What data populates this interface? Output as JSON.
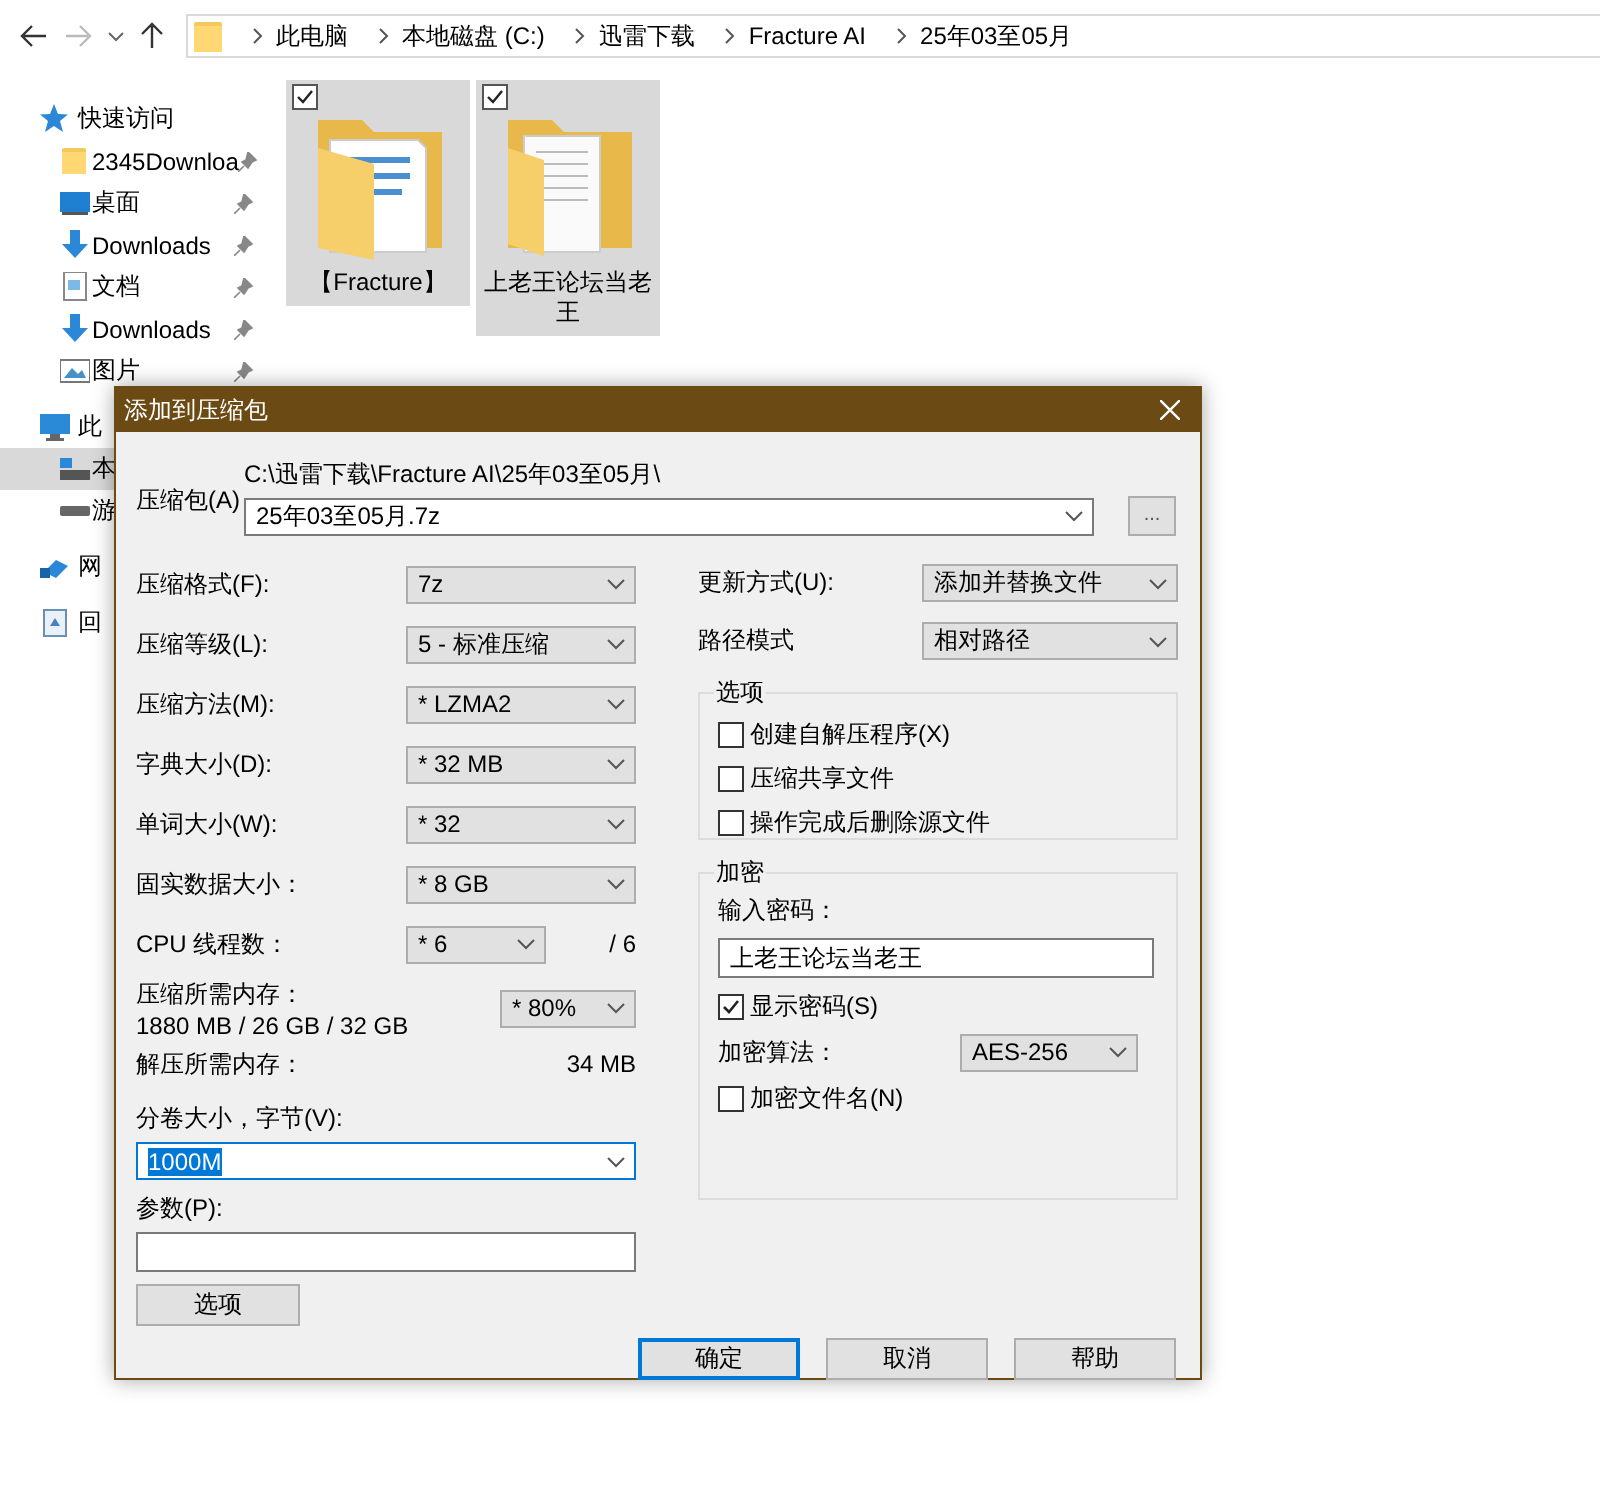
{
  "explorer": {
    "breadcrumb": [
      "此电脑",
      "本地磁盘 (C:)",
      "迅雷下载",
      "Fracture AI",
      "25年03至05月"
    ],
    "sidebar": [
      {
        "label": "快速访问",
        "kind": "star",
        "selected": false,
        "children": [
          {
            "label": "2345Downloa",
            "kind": "folder",
            "pinned": true,
            "selected": false
          },
          {
            "label": "桌面",
            "kind": "desktop",
            "pinned": true,
            "selected": false
          },
          {
            "label": "Downloads",
            "kind": "download",
            "pinned": true,
            "selected": false
          },
          {
            "label": "文档",
            "kind": "document",
            "pinned": true,
            "selected": false
          },
          {
            "label": "Downloads",
            "kind": "download",
            "pinned": true,
            "selected": false
          },
          {
            "label": "图片",
            "kind": "picture",
            "pinned": true,
            "selected": false
          }
        ]
      },
      {
        "label": "此",
        "kind": "pc",
        "selected": false,
        "children": [
          {
            "label": "本",
            "kind": "drive",
            "selected": true
          },
          {
            "label": "游",
            "kind": "disk",
            "selected": false
          }
        ]
      },
      {
        "label": "网",
        "kind": "network",
        "selected": false
      },
      {
        "label": "回",
        "kind": "recycle",
        "selected": false
      }
    ],
    "files": [
      {
        "name": "【Fracture】",
        "checked": true,
        "selected": true
      },
      {
        "name": "上老王论坛当老王",
        "checked": true,
        "selected": true
      }
    ]
  },
  "dialog": {
    "title": "添加到压缩包",
    "archive": {
      "label": "压缩包(A)",
      "folder": "C:\\迅雷下载\\Fracture AI\\25年03至05月\\",
      "name": "25年03至05月.7z"
    },
    "browse_button": "...",
    "settings": [
      {
        "kind": "combo",
        "label": "压缩格式(F):",
        "value": "7z"
      },
      {
        "kind": "combo",
        "label": "压缩等级(L):",
        "value": "5 - 标准压缩"
      },
      {
        "kind": "combo",
        "label": "压缩方法(M):",
        "value": "* LZMA2"
      },
      {
        "kind": "combo",
        "label": "字典大小(D):",
        "value": "* 32 MB"
      },
      {
        "kind": "combo",
        "label": "单词大小(W):",
        "value": "* 32"
      },
      {
        "kind": "combo",
        "label": "固实数据大小：",
        "value": "* 8 GB"
      },
      {
        "kind": "threads",
        "label": "CPU 线程数：",
        "value": "* 6",
        "total": "/ 6"
      },
      {
        "kind": "memory",
        "label": "压缩所需内存：",
        "detail": "1880 MB / 26 GB / 32 GB",
        "value": "* 80%"
      },
      {
        "kind": "info",
        "label": "解压所需内存：",
        "value": "34 MB"
      },
      {
        "kind": "volume",
        "label": "分卷大小，字节(V):",
        "value": "1000M",
        "selected": true
      },
      {
        "kind": "text",
        "label": "参数(P):"
      }
    ],
    "options_button": "选项",
    "update_mode": {
      "label": "更新方式(U):",
      "value": "添加并替换文件"
    },
    "path_mode": {
      "label": "路径模式",
      "value": "相对路径"
    },
    "options": {
      "title": "选项",
      "items": [
        {
          "label": "创建自解压程序(X)",
          "checked": false
        },
        {
          "label": "压缩共享文件",
          "checked": false
        },
        {
          "label": "操作完成后删除源文件",
          "checked": false
        }
      ]
    },
    "encryption": {
      "title": "加密",
      "password_label": "输入密码：",
      "password": "上老王论坛当老王",
      "show_password": {
        "label": "显示密码(S)",
        "checked": true
      },
      "method_label": "加密算法：",
      "method": "AES-256",
      "encrypt_names": {
        "label": "加密文件名(N)",
        "checked": false
      }
    },
    "buttons": [
      {
        "label": "确定",
        "default": true
      },
      {
        "label": "取消",
        "default": false
      },
      {
        "label": "帮助",
        "default": false
      }
    ]
  }
}
